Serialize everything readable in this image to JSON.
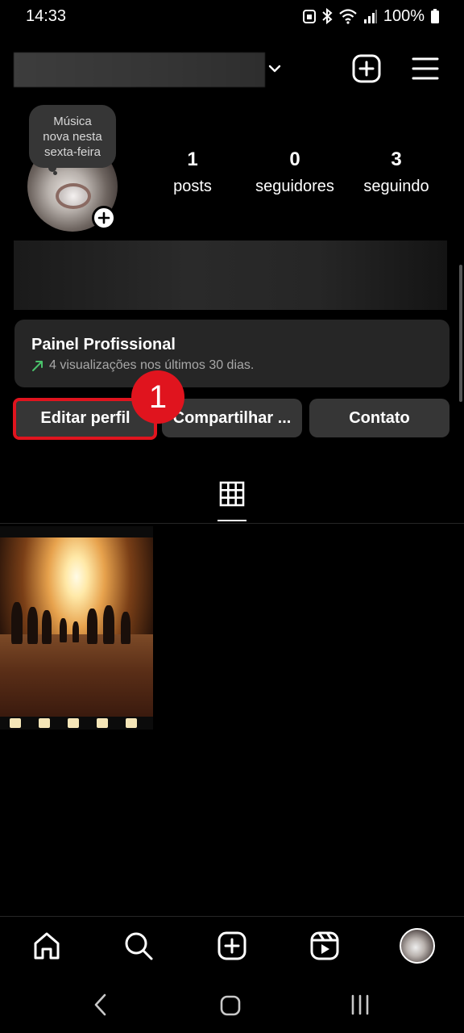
{
  "status_bar": {
    "time": "14:33",
    "battery": "100%"
  },
  "header": {
    "username": "",
    "icons": [
      "chevron-down-icon",
      "new-post-icon",
      "menu-icon"
    ]
  },
  "profile": {
    "note": {
      "line1": "Música",
      "line2": "nova nesta",
      "line3": "sexta-feira"
    },
    "stats": {
      "posts_value": "1",
      "posts_label": "posts",
      "followers_value": "0",
      "followers_label": "seguidores",
      "following_value": "3",
      "following_label": "seguindo"
    }
  },
  "dashboard": {
    "title": "Painel Profissional",
    "subtitle": "4 visualizações nos últimos 30 dias.",
    "trend_color": "#4ac26b"
  },
  "actions": {
    "edit_label": "Editar perfil",
    "share_label": "Compartilhar ...",
    "contact_label": "Contato"
  },
  "annotation": {
    "step_number": "1",
    "color": "#e0141e"
  },
  "tabs": {
    "active": "grid-icon"
  },
  "bottom_nav": {
    "items": [
      "home-icon",
      "search-icon",
      "create-icon",
      "reels-icon",
      "profile-avatar"
    ]
  }
}
